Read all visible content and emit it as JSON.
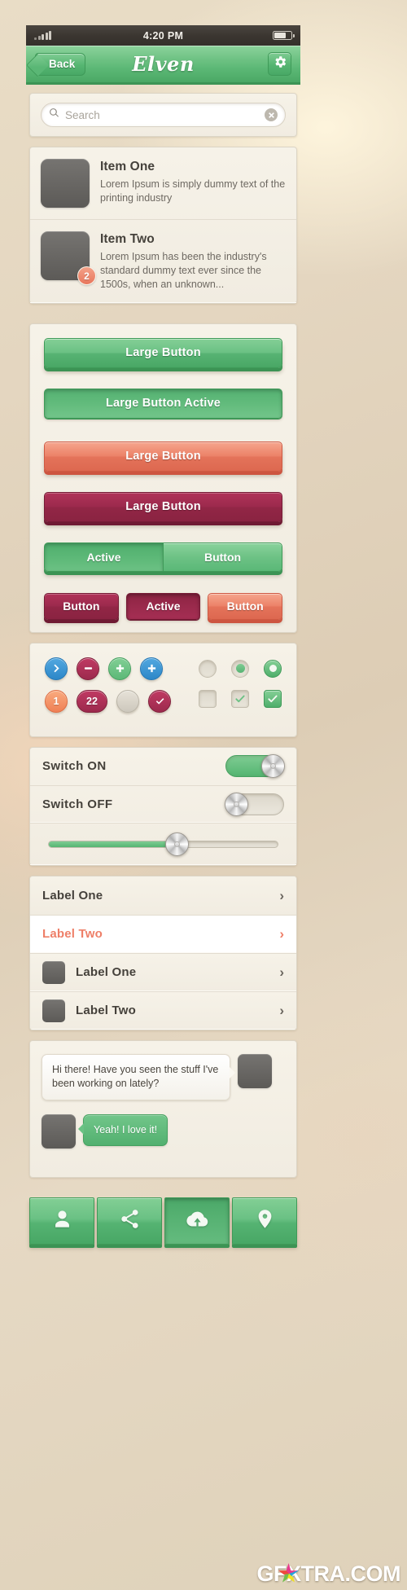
{
  "statusbar": {
    "time": "4:20 PM",
    "signal_icon": "signal-bars-icon",
    "battery_icon": "battery-icon"
  },
  "navbar": {
    "back_label": "Back",
    "title": "Elven",
    "settings_icon": "gear-icon"
  },
  "search": {
    "placeholder": "Search",
    "value": "",
    "search_icon": "search-icon",
    "clear_icon": "clear-circle-icon"
  },
  "list": {
    "items": [
      {
        "title": "Item One",
        "subtitle": "Lorem Ipsum is simply dummy text of the printing industry",
        "badge": ""
      },
      {
        "title": "Item Two",
        "subtitle": "Lorem Ipsum has been the industry's standard dummy text ever since the 1500s, when an unknown...",
        "badge": "2"
      }
    ]
  },
  "buttons": {
    "large": [
      {
        "label": "Large Button",
        "style": "green"
      },
      {
        "label": "Large Button Active",
        "style": "green-active"
      },
      {
        "label": "Large Button",
        "style": "salmon"
      },
      {
        "label": "Large Button",
        "style": "crimson"
      }
    ],
    "segmented": [
      {
        "label": "Active",
        "state": "on"
      },
      {
        "label": "Button",
        "state": "off"
      }
    ],
    "small": [
      {
        "label": "Button",
        "style": "crimson"
      },
      {
        "label": "Active",
        "style": "crimson-active"
      },
      {
        "label": "Button",
        "style": "salmon"
      }
    ]
  },
  "badges": {
    "row1": [
      {
        "icon": "chevron-right-icon",
        "color": "#2d87c8",
        "label": ""
      },
      {
        "icon": "minus-icon",
        "color": "#9c2a4d",
        "label": ""
      },
      {
        "icon": "plus-icon",
        "color": "#5cb877",
        "label": ""
      },
      {
        "icon": "plus-icon",
        "color": "#2d87c8",
        "label": ""
      }
    ],
    "row2": [
      {
        "icon": "count-badge",
        "color": "#ef8055",
        "label": "1"
      },
      {
        "icon": "count-badge",
        "color": "#9c2a4d",
        "label": "22"
      },
      {
        "icon": "empty-badge",
        "color": "#cdc8bc",
        "label": ""
      },
      {
        "icon": "check-icon",
        "color": "#9c2a4d",
        "label": ""
      }
    ],
    "radios": [
      {
        "name": "radio-empty",
        "state": "empty"
      },
      {
        "name": "radio-soft-selected",
        "state": "soft"
      },
      {
        "name": "radio-selected",
        "state": "full"
      }
    ],
    "checkboxes": [
      {
        "name": "checkbox-empty",
        "state": "empty"
      },
      {
        "name": "checkbox-soft-checked",
        "state": "soft"
      },
      {
        "name": "checkbox-checked",
        "state": "full"
      }
    ]
  },
  "switches": {
    "rows": [
      {
        "label": "Switch ON",
        "state": "on"
      },
      {
        "label": "Switch OFF",
        "state": "off"
      }
    ],
    "slider": {
      "value_percent": 56
    }
  },
  "labels": {
    "rows": [
      {
        "label": "Label One",
        "style": "plain",
        "thumb": false,
        "chevron": "›"
      },
      {
        "label": "Label Two",
        "style": "highlight",
        "thumb": false,
        "chevron": "›"
      },
      {
        "label": "Label One",
        "style": "plain",
        "thumb": true,
        "chevron": "›"
      },
      {
        "label": "Label Two",
        "style": "plain",
        "thumb": true,
        "chevron": "›"
      }
    ]
  },
  "chat": {
    "messages": [
      {
        "text": "Hi there! Have you seen the stuff I've been working on lately?",
        "side": "them"
      },
      {
        "text": "Yeah! I love it!",
        "side": "me"
      }
    ]
  },
  "tabbar": {
    "tabs": [
      {
        "icon": "person-icon",
        "active": false
      },
      {
        "icon": "share-icon",
        "active": false
      },
      {
        "icon": "cloud-upload-icon",
        "active": true
      },
      {
        "icon": "map-pin-icon",
        "active": false
      }
    ]
  },
  "watermark": {
    "text": "GFXTRA.COM"
  },
  "colors": {
    "green": "#5cb877",
    "green_dark": "#3f9a58",
    "salmon": "#ec8268",
    "crimson": "#9c2a4d",
    "blue": "#2d87c8",
    "panel_bg": "#f4f0e6",
    "text": "#45413b"
  }
}
